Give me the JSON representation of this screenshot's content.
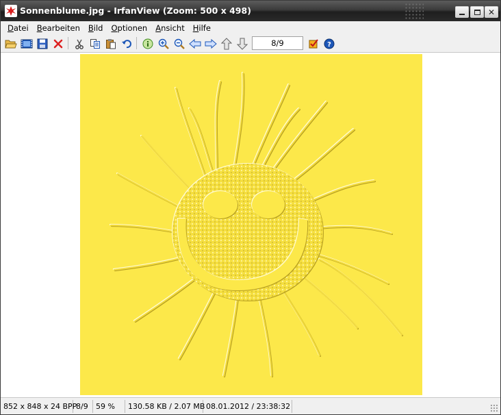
{
  "window": {
    "title": "Sonnenblume.jpg - IrfanView (Zoom: 500 x 498)"
  },
  "menu": [
    "Datei",
    "Bearbeiten",
    "Bild",
    "Optionen",
    "Ansicht",
    "Hilfe"
  ],
  "toolbar": {
    "icons": [
      "open-folder-icon",
      "slideshow-icon",
      "save-icon",
      "delete-icon",
      "cut-icon",
      "copy-icon",
      "paste-icon",
      "undo-icon",
      "info-icon",
      "zoom-in-icon",
      "zoom-out-icon",
      "previous-icon",
      "next-icon",
      "first-page-icon",
      "last-page-icon",
      "page-counter",
      "thumbnails-icon",
      "help-icon"
    ],
    "page_counter": "8/9"
  },
  "status": {
    "dimensions": "852 x 848 x 24 BPP",
    "index": "8/9",
    "zoom": "59 %",
    "size": "130.58 KB / 2.07 MB",
    "datetime": "08.01.2012 / 23:38:32"
  },
  "colors": {
    "titlebar": "#2a2a2a",
    "image_yellow": "#fce84a",
    "chrome": "#f0f0f0"
  }
}
